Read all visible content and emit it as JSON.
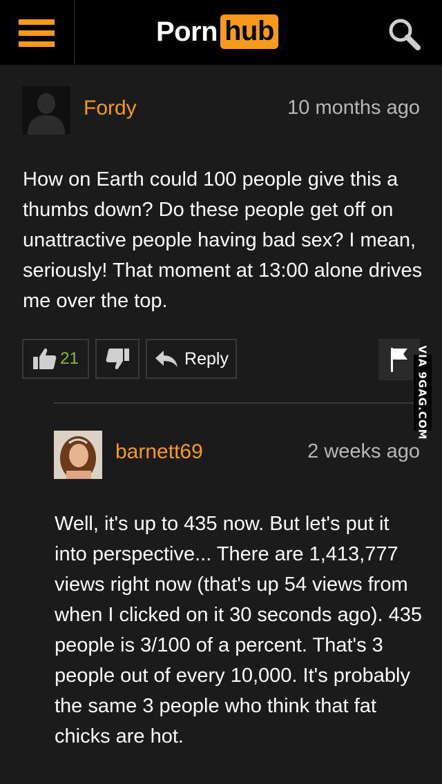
{
  "header": {
    "logo_part1": "Porn",
    "logo_part2": "hub",
    "accent_color": "#f79a1a",
    "menu_icon": "hamburger-icon",
    "search_icon": "search-icon"
  },
  "comments": [
    {
      "username": "Fordy",
      "timestamp": "10 months ago",
      "text": "How on Earth could 100 people give this a thumbs down? Do these people get off on unattractive people having bad sex? I mean, seriously! That moment at 13:00 alone drives me over the top.",
      "likes": "21",
      "reply_label": "Reply"
    },
    {
      "username": "barnett69",
      "timestamp": "2 weeks ago",
      "text": "Well, it's up to 435 now. But let's put it into perspective... There are 1,413,777 views right now (that's up 54 views from when I clicked on it 30 seconds ago). 435 people is 3/100 of a percent. That's 3 people out of every 10,000. It's probably the same 3 people who think that fat chicks are hot."
    }
  ],
  "watermark": "VIA 9GAG.COM"
}
